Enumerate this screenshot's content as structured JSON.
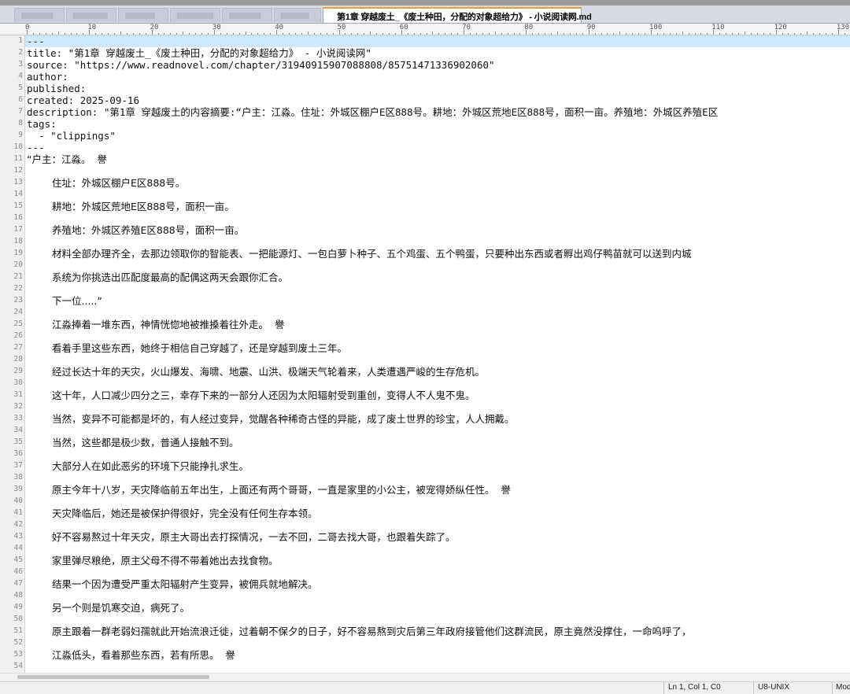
{
  "tab": {
    "title": "第1章 穿越废土_《废土种田，分配的对象超给力》 - 小说阅读网.md",
    "close_glyph": "✕"
  },
  "ruler": {
    "labels": [
      "0",
      "10",
      "20",
      "30",
      "40",
      "50",
      "60",
      "70",
      "80",
      "90",
      "100",
      "110",
      "120",
      "130"
    ]
  },
  "lines": [
    {
      "n": "1",
      "text": "---",
      "cjk": false,
      "indent": false
    },
    {
      "n": "2",
      "text": "title: \"第1章 穿越废土_《废土种田，分配的对象超给力》 - 小说阅读网\"",
      "cjk": false,
      "indent": false
    },
    {
      "n": "3",
      "text": "source: \"https://www.readnovel.com/chapter/31940915907088808/85751471336902060\"",
      "cjk": false,
      "indent": false
    },
    {
      "n": "4",
      "text": "author:",
      "cjk": false,
      "indent": false
    },
    {
      "n": "5",
      "text": "published:",
      "cjk": false,
      "indent": false
    },
    {
      "n": "6",
      "text": "created: 2025-09-16",
      "cjk": false,
      "indent": false
    },
    {
      "n": "7",
      "text": "description: \"第1章 穿越废土的内容摘要:“户主：江淼。住址：外城区棚户E区888号。耕地：外城区荒地E区888号，面积一亩。养殖地：外城区养殖E区",
      "cjk": false,
      "indent": false
    },
    {
      "n": "8",
      "text": "tags:",
      "cjk": false,
      "indent": false
    },
    {
      "n": "9",
      "text": "  - \"clippings\"",
      "cjk": false,
      "indent": false
    },
    {
      "n": "10",
      "text": "---",
      "cjk": false,
      "indent": false
    },
    {
      "n": "11",
      "text": "“户主：江淼。  譽",
      "cjk": true,
      "indent": false
    },
    {
      "n": "12",
      "text": "",
      "cjk": true,
      "indent": false
    },
    {
      "n": "13",
      "text": "住址：外城区棚户E区888号。",
      "cjk": true,
      "indent": true
    },
    {
      "n": "14",
      "text": "",
      "cjk": true,
      "indent": false
    },
    {
      "n": "15",
      "text": "耕地：外城区荒地E区888号，面积一亩。",
      "cjk": true,
      "indent": true
    },
    {
      "n": "16",
      "text": "",
      "cjk": true,
      "indent": false
    },
    {
      "n": "17",
      "text": "养殖地：外城区养殖E区888号，面积一亩。",
      "cjk": true,
      "indent": true
    },
    {
      "n": "18",
      "text": "",
      "cjk": true,
      "indent": false
    },
    {
      "n": "19",
      "text": "材料全部办理齐全，去那边领取你的智能表、一把能源灯、一包白萝卜种子、五个鸡蛋、五个鸭蛋，只要种出东西或者孵出鸡仔鸭苗就可以送到内城",
      "cjk": true,
      "indent": true
    },
    {
      "n": "20",
      "text": "",
      "cjk": true,
      "indent": false
    },
    {
      "n": "21",
      "text": "系统为你挑选出匹配度最高的配偶这两天会跟你汇合。",
      "cjk": true,
      "indent": true
    },
    {
      "n": "22",
      "text": "",
      "cjk": true,
      "indent": false
    },
    {
      "n": "23",
      "text": "下一位.....”",
      "cjk": true,
      "indent": true
    },
    {
      "n": "24",
      "text": "",
      "cjk": true,
      "indent": false
    },
    {
      "n": "25",
      "text": "江淼捧着一堆东西，神情恍惚地被推搡着往外走。  譽",
      "cjk": true,
      "indent": true
    },
    {
      "n": "26",
      "text": "",
      "cjk": true,
      "indent": false
    },
    {
      "n": "27",
      "text": "看着手里这些东西，她终于相信自己穿越了，还是穿越到废土三年。",
      "cjk": true,
      "indent": true
    },
    {
      "n": "28",
      "text": "",
      "cjk": true,
      "indent": false
    },
    {
      "n": "29",
      "text": "经过长达十年的天灾，火山爆发、海啸、地震、山洪、极端天气轮着来，人类遭遇严峻的生存危机。",
      "cjk": true,
      "indent": true
    },
    {
      "n": "30",
      "text": "",
      "cjk": true,
      "indent": false
    },
    {
      "n": "31",
      "text": "这十年，人口减少四分之三，幸存下来的一部分人还因为太阳辐射受到重创，变得人不人鬼不鬼。",
      "cjk": true,
      "indent": true
    },
    {
      "n": "32",
      "text": "",
      "cjk": true,
      "indent": false
    },
    {
      "n": "33",
      "text": "当然，变异不可能都是坏的，有人经过变异，觉醒各种稀奇古怪的异能，成了废土世界的珍宝，人人拥戴。",
      "cjk": true,
      "indent": true
    },
    {
      "n": "34",
      "text": "",
      "cjk": true,
      "indent": false
    },
    {
      "n": "35",
      "text": "当然，这些都是极少数，普通人接触不到。",
      "cjk": true,
      "indent": true
    },
    {
      "n": "36",
      "text": "",
      "cjk": true,
      "indent": false
    },
    {
      "n": "37",
      "text": "大部分人在如此恶劣的环境下只能挣扎求生。",
      "cjk": true,
      "indent": true
    },
    {
      "n": "38",
      "text": "",
      "cjk": true,
      "indent": false
    },
    {
      "n": "39",
      "text": "原主今年十八岁，天灾降临前五年出生，上面还有两个哥哥，一直是家里的小公主，被宠得娇纵任性。  譽",
      "cjk": true,
      "indent": true
    },
    {
      "n": "40",
      "text": "",
      "cjk": true,
      "indent": false
    },
    {
      "n": "41",
      "text": "天灾降临后，她还是被保护得很好，完全没有任何生存本领。",
      "cjk": true,
      "indent": true
    },
    {
      "n": "42",
      "text": "",
      "cjk": true,
      "indent": false
    },
    {
      "n": "43",
      "text": "好不容易熬过十年天灾，原主大哥出去打探情况，一去不回，二哥去找大哥，也跟着失踪了。",
      "cjk": true,
      "indent": true
    },
    {
      "n": "44",
      "text": "",
      "cjk": true,
      "indent": false
    },
    {
      "n": "45",
      "text": "家里弹尽粮绝，原主父母不得不带着她出去找食物。",
      "cjk": true,
      "indent": true
    },
    {
      "n": "46",
      "text": "",
      "cjk": true,
      "indent": false
    },
    {
      "n": "47",
      "text": "结果一个因为遭受严重太阳辐射产生变异，被佣兵就地解决。",
      "cjk": true,
      "indent": true
    },
    {
      "n": "48",
      "text": "",
      "cjk": true,
      "indent": false
    },
    {
      "n": "49",
      "text": "另一个则是饥寒交迫，病死了。",
      "cjk": true,
      "indent": true
    },
    {
      "n": "50",
      "text": "",
      "cjk": true,
      "indent": false
    },
    {
      "n": "51",
      "text": "原主跟着一群老弱妇孺就此开始流浪迁徙，过着朝不保夕的日子，好不容易熬到灾后第三年政府接管他们这群流民，原主竟然没撑住，一命呜呼了，",
      "cjk": true,
      "indent": true
    },
    {
      "n": "52",
      "text": "",
      "cjk": true,
      "indent": false
    },
    {
      "n": "53",
      "text": "江淼低头，看着那些东西，若有所思。  譽",
      "cjk": true,
      "indent": true
    },
    {
      "n": "54",
      "text": "",
      "cjk": true,
      "indent": false
    }
  ],
  "status": {
    "position": "Ln 1, Col 1, C0",
    "encoding": "U8-UNIX",
    "mode": "Mod"
  }
}
